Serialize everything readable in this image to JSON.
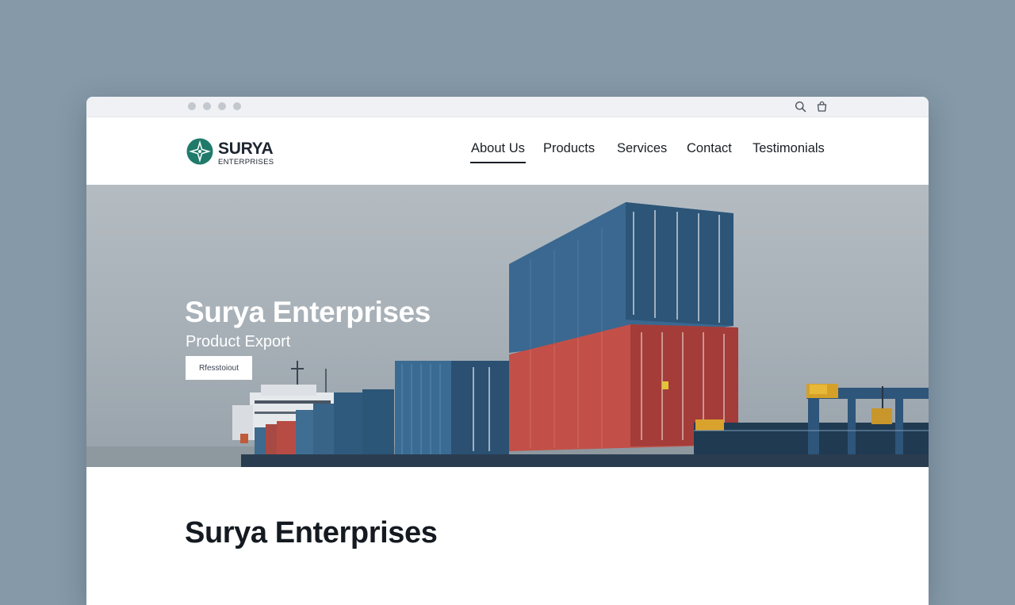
{
  "colors": {
    "desktop_background": "#8599a8",
    "brand": "#1f7a6a",
    "text": "#1a1f26",
    "container_blue": "#2e5677",
    "container_red": "#b54540"
  },
  "browser": {
    "window_controls": [
      "dot",
      "dot",
      "dot",
      "dot"
    ],
    "icons": [
      "search-icon",
      "shopping-bag-icon"
    ]
  },
  "header": {
    "logo": {
      "icon": "compass-star-logo-icon",
      "name": "SURYA",
      "tagline": "ENTERPRISES"
    },
    "nav": [
      {
        "label": "About Us",
        "active": true
      },
      {
        "label": "Products",
        "active": false
      },
      {
        "label": "Services",
        "active": false
      },
      {
        "label": "Contact",
        "active": false
      },
      {
        "label": "Testimonials",
        "active": false
      }
    ]
  },
  "hero": {
    "title": "Surya Enterprises",
    "subtitle": "Product Export",
    "button_label": "Rfesstoiout",
    "image": "cargo-ship-with-shipping-containers"
  },
  "main": {
    "section_title": "Surya Enterprises"
  }
}
